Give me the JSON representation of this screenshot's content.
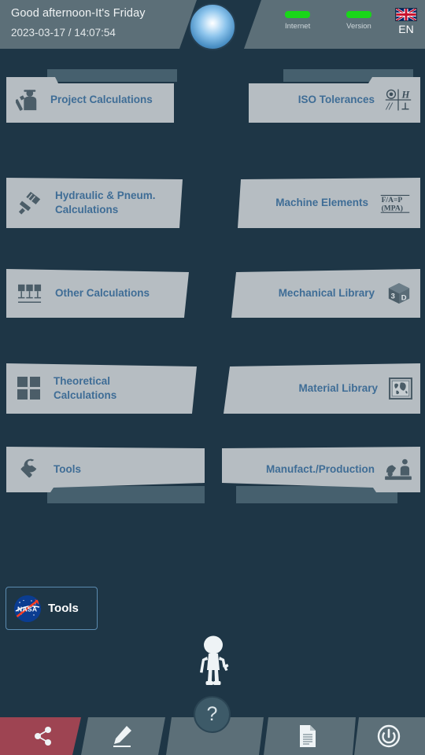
{
  "header": {
    "greeting": "Good afternoon-It's Friday",
    "datetime": "2023-03-17 / 14:07:54",
    "status": [
      {
        "label": "Internet",
        "color": "#19d619"
      },
      {
        "label": "Version",
        "color": "#19d619"
      }
    ],
    "language": {
      "code": "EN",
      "flag": "uk-flag-icon"
    },
    "orb": "glowing-orb-icon"
  },
  "menu": {
    "rows": [
      {
        "left": {
          "label": "Project Calculations",
          "icon": "engineer-icon",
          "style": "tab"
        },
        "right": {
          "label": "ISO Tolerances",
          "icon": "gdt-symbols-icon",
          "style": "tab"
        }
      },
      {
        "left": {
          "label": "Hydraulic & Pneum.\nCalculations",
          "icon": "piston-icon",
          "style": "plain"
        },
        "right": {
          "label": "Machine Elements",
          "icon": "formula-icon",
          "style": "plain"
        }
      },
      {
        "left": {
          "label": "Other Calculations",
          "icon": "bar-chart-icon",
          "style": "plain"
        },
        "right": {
          "label": "Mechanical Library",
          "icon": "cube-3d-icon",
          "style": "plain"
        }
      },
      {
        "left": {
          "label": "Theoretical\nCalculations",
          "icon": "grid-icon",
          "style": "plain"
        },
        "right": {
          "label": "Material Library",
          "icon": "world-map-icon",
          "style": "plain"
        }
      },
      {
        "left": {
          "label": "Tools",
          "icon": "wrench-icon",
          "style": "shelf"
        },
        "right": {
          "label": "Manufact./Production",
          "icon": "worker-icon",
          "style": "shelf"
        }
      }
    ]
  },
  "nasa_button": {
    "label": "Tools",
    "logo": "nasa-logo-icon"
  },
  "mascot": "robot-mascot-icon",
  "help_button": {
    "label": "?"
  },
  "bottom_bar": {
    "items": [
      {
        "name": "share",
        "icon": "share-icon",
        "color": "#9e4452"
      },
      {
        "name": "edit",
        "icon": "pencil-icon",
        "color": "#5c6f78"
      },
      {
        "name": "middle",
        "icon": "",
        "color": "#5c6f78"
      },
      {
        "name": "doc",
        "icon": "document-icon",
        "color": "#5c6f78"
      },
      {
        "name": "power",
        "icon": "power-icon",
        "color": "#5c6f78"
      }
    ]
  },
  "colors": {
    "background": "#1e3646",
    "card": "#b6bdc2",
    "card_text": "#3f6d96",
    "panel": "#5c6f78",
    "tab_back": "#46606e",
    "accent_red": "#9e4452",
    "led_green": "#19d619"
  }
}
